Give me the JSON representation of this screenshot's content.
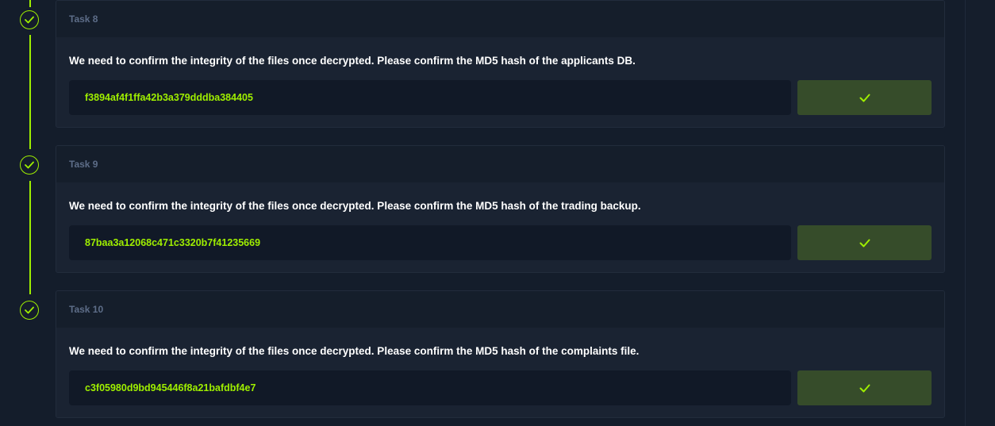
{
  "tasks": [
    {
      "label": "Task 8",
      "question": "We need to confirm the integrity of the files once decrypted. Please confirm the MD5 hash of the applicants DB.",
      "answer": "f3894af4f1ffa42b3a379dddba384405",
      "status_icon": "check-circle-icon",
      "submit_icon": "checkmark-icon"
    },
    {
      "label": "Task 9",
      "question": "We need to confirm the integrity of the files once decrypted. Please confirm the MD5 hash of the trading backup.",
      "answer": "87baa3a12068c471c3320b7f41235669",
      "status_icon": "check-circle-icon",
      "submit_icon": "checkmark-icon"
    },
    {
      "label": "Task 10",
      "question": "We need to confirm the integrity of the files once decrypted. Please confirm the MD5 hash of the complaints file.",
      "answer": "c3f05980d9bd945446f8a21bafdbf4e7",
      "status_icon": "check-circle-icon",
      "submit_icon": "checkmark-icon"
    }
  ],
  "colors": {
    "accent": "#9fef00",
    "background": "#141d2b",
    "card": "#1a2332",
    "card_header": "#151e2b",
    "input": "#111927",
    "submit_button": "#364c2a",
    "task_label": "#5d6d88"
  }
}
